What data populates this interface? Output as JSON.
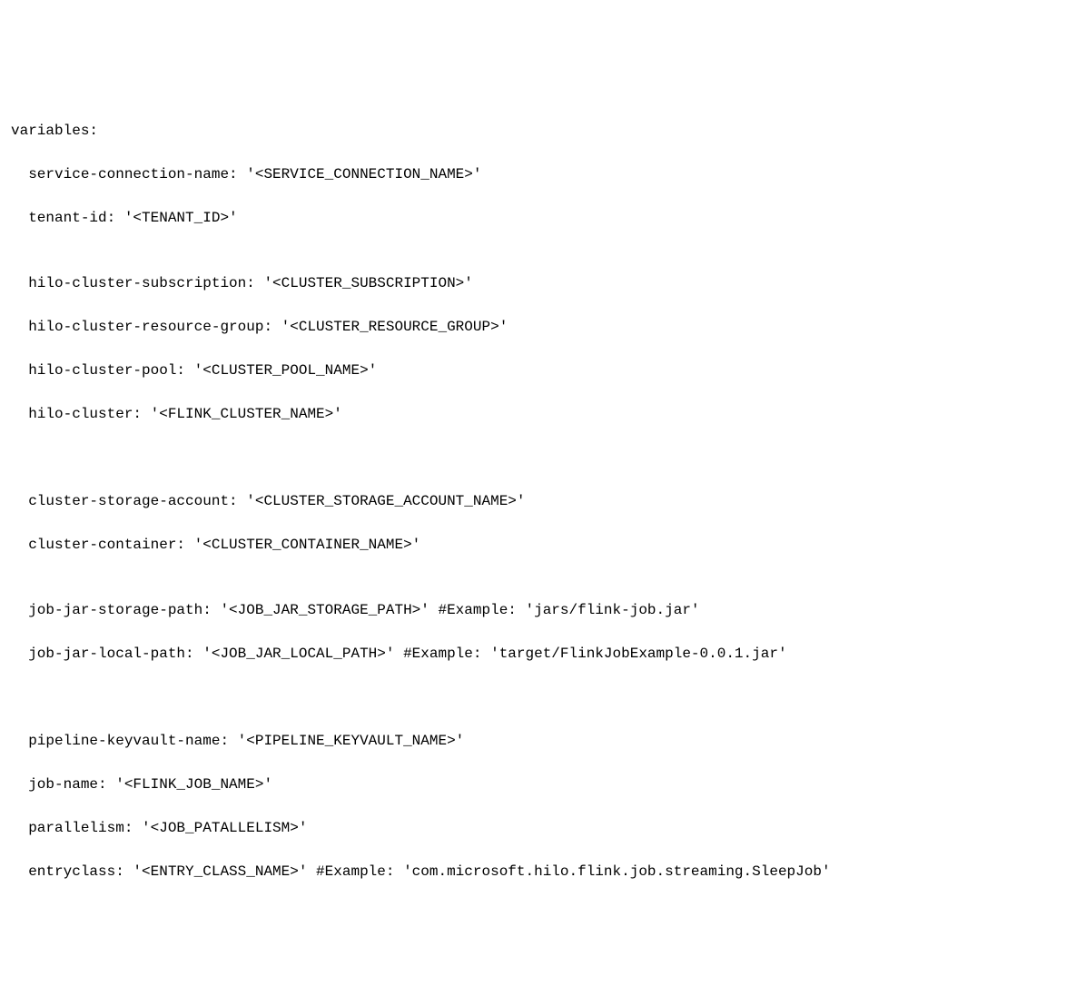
{
  "code": {
    "header": "variables:",
    "lines": [
      "  service-connection-name: '<SERVICE_CONNECTION_NAME>'",
      "  tenant-id: '<TENANT_ID>'",
      "",
      "  hilo-cluster-subscription: '<CLUSTER_SUBSCRIPTION>'",
      "  hilo-cluster-resource-group: '<CLUSTER_RESOURCE_GROUP>'",
      "  hilo-cluster-pool: '<CLUSTER_POOL_NAME>'",
      "  hilo-cluster: '<FLINK_CLUSTER_NAME>'",
      "",
      "",
      "  cluster-storage-account: '<CLUSTER_STORAGE_ACCOUNT_NAME>'",
      "  cluster-container: '<CLUSTER_CONTAINER_NAME>'",
      "",
      "  job-jar-storage-path: '<JOB_JAR_STORAGE_PATH>' #Example: 'jars/flink-job.jar'",
      "  job-jar-local-path: '<JOB_JAR_LOCAL_PATH>' #Example: 'target/FlinkJobExample-0.0.1.jar'",
      "",
      "",
      "  pipeline-keyvault-name: '<PIPELINE_KEYVAULT_NAME>'",
      "  job-name: '<FLINK_JOB_NAME>'",
      "  parallelism: '<JOB_PATALLELISM>'",
      "  entryclass: '<ENTRY_CLASS_NAME>' #Example: 'com.microsoft.hilo.flink.job.streaming.SleepJob'"
    ]
  }
}
